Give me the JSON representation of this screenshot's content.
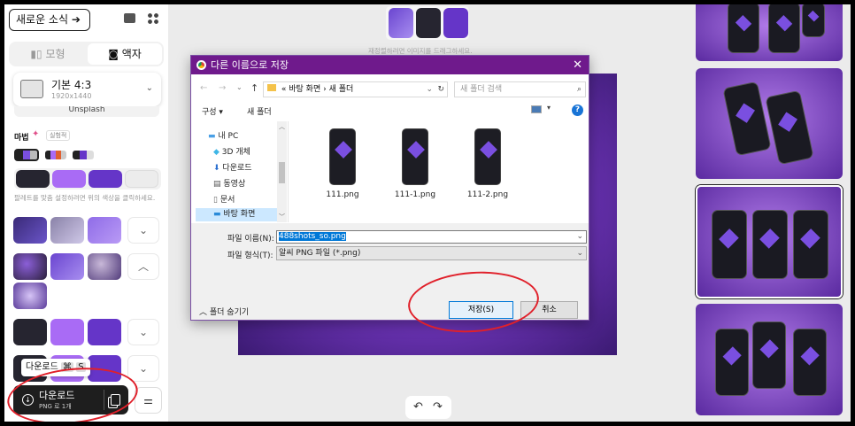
{
  "sidebar": {
    "news_button": "새로운 소식",
    "tabs": [
      "모형",
      "액자"
    ],
    "size": {
      "name": "기본 4:3",
      "dims": "1920x1440"
    },
    "unsplash": "Unsplash",
    "magic_label": "마법",
    "magic_tag": "실험적",
    "palette_hint": "팔레트를 맞춤 설정하려면 위의 색상을 클릭하세요.",
    "download": {
      "label": "다운로드",
      "sub": "PNG 로 1개",
      "tooltip": "다운로드",
      "shortcut_key": "⌘",
      "shortcut_char": "S"
    }
  },
  "top": {
    "hint": "재정렬하려면 이미지를 드래그하세요."
  },
  "dialog": {
    "title": "다른 이름으로 저장",
    "breadcrumb": [
      "«",
      "바탕 화면",
      "새 폴더"
    ],
    "search_placeholder": "새 폴더 검색",
    "organize": "구성",
    "new_folder": "새 폴더",
    "tree": [
      "내 PC",
      "3D 개체",
      "다운로드",
      "동영상",
      "문서",
      "바탕 화면"
    ],
    "files": [
      "111.png",
      "111-1.png",
      "111-2.png"
    ],
    "filename_label": "파일 이름(N):",
    "filename_value": "488shots_so.png",
    "filetype_label": "파일 형식(T):",
    "filetype_value": "알씨 PNG 파일 (*.png)",
    "hide_folders": "폴더 숨기기",
    "save": "저장(S)",
    "cancel": "취소"
  },
  "colors": {
    "accent": "#6f1a8c",
    "highlight": "#e0202a"
  }
}
